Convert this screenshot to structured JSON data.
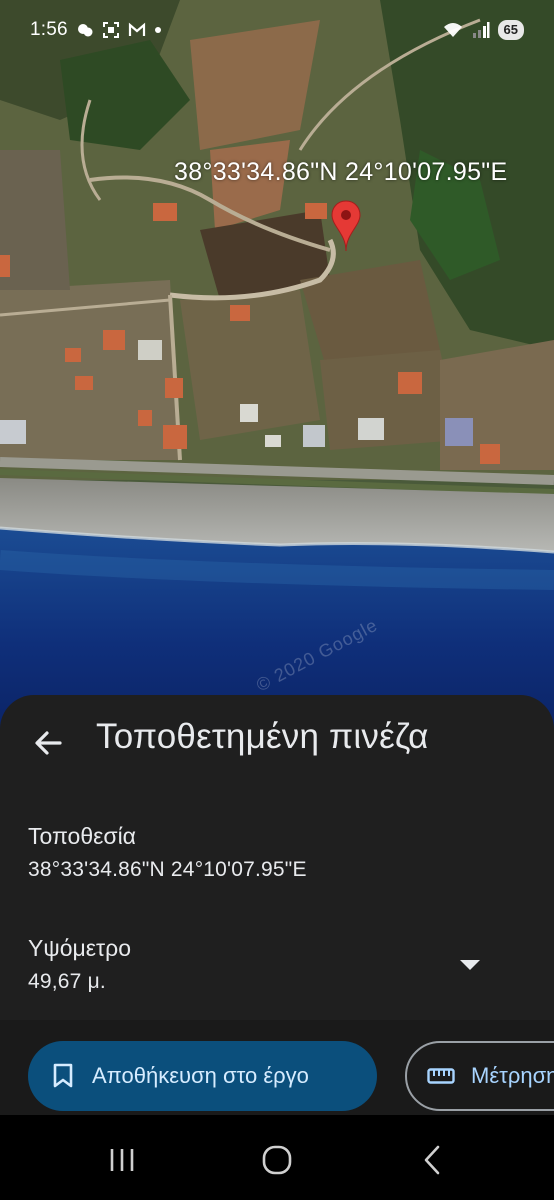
{
  "status_bar": {
    "time": "1:56",
    "battery": "65",
    "icons": [
      "weather-icon",
      "screenshot-icon",
      "gmail-icon",
      "dot-icon",
      "wifi-icon",
      "signal-icon"
    ]
  },
  "map": {
    "coordinate_label": "38°33'34.86\"N 24°10'07.95\"E",
    "pin_color": "#e53935",
    "watermark": "© 2020 Google"
  },
  "sheet": {
    "title": "Τοποθετημένη πινέζα",
    "location": {
      "label": "Τοποθεσία",
      "value": "38°33'34.86\"N 24°10'07.95\"E"
    },
    "elevation": {
      "label": "Υψόμετρο",
      "value": "49,67 μ."
    },
    "actions": {
      "save_label": "Αποθήκευση στο έργο",
      "measure_label": "Μέτρηση"
    }
  },
  "colors": {
    "sheet_bg": "#1f1f1f",
    "save_button_bg": "#0b4f7c",
    "save_button_text": "#d6ecff",
    "measure_button_text": "#a8d4ff"
  },
  "navbar": {
    "buttons": [
      "recents-icon",
      "home-icon",
      "back-nav-icon"
    ]
  }
}
